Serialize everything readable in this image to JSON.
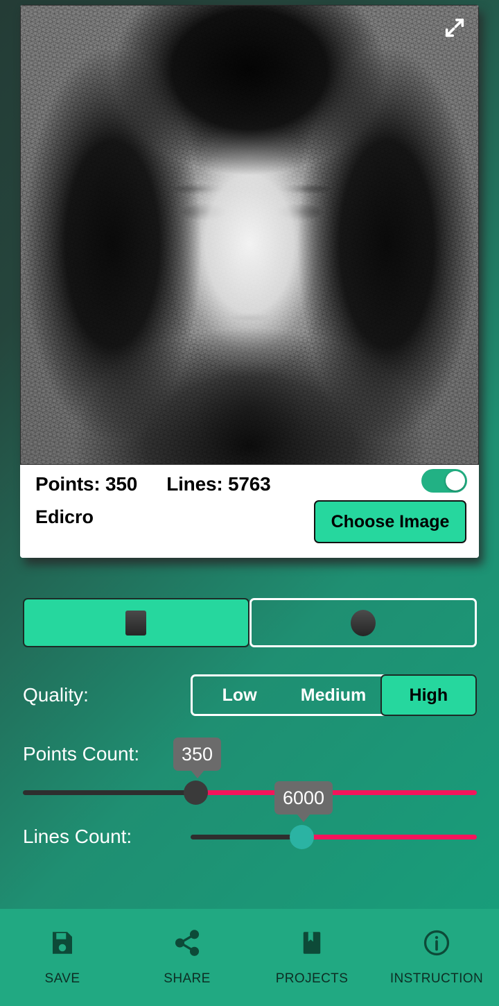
{
  "app": {
    "name": "Edicro",
    "accent_green": "#26d79e",
    "nav_green": "#21a982",
    "slider_active": "#f4145b",
    "bubble_gray": "#6b6b6b"
  },
  "preview": {
    "expand_icon": "expand-arrows-icon",
    "image_description": "string-art portrait of a woman"
  },
  "stats": {
    "points": "Points: 350",
    "lines": "Lines: 5763"
  },
  "toggle": {
    "name": "preview-toggle",
    "state": "on"
  },
  "choose_image": {
    "label": "Choose Image"
  },
  "shape": {
    "options": [
      {
        "icon": "square-shape-icon",
        "selected": true
      },
      {
        "icon": "circle-shape-icon",
        "selected": false
      }
    ]
  },
  "quality": {
    "label": "Quality:",
    "options": [
      {
        "label": "Low",
        "active": false
      },
      {
        "label": "Medium",
        "active": false
      },
      {
        "label": "High",
        "active": true
      }
    ]
  },
  "sliders": [
    {
      "label": "Points Count:",
      "value": "350",
      "thumb_color": "#3a3a3a"
    },
    {
      "label": "Lines Count:",
      "value": "6000",
      "thumb_color": "#2bb3a3"
    }
  ],
  "bottom_nav": [
    {
      "label": "SAVE",
      "icon": "save-floppy-icon"
    },
    {
      "label": "SHARE",
      "icon": "share-icon"
    },
    {
      "label": "PROJECTS",
      "icon": "bookmark-book-icon"
    },
    {
      "label": "INSTRUCTION",
      "icon": "info-circle-icon"
    }
  ]
}
